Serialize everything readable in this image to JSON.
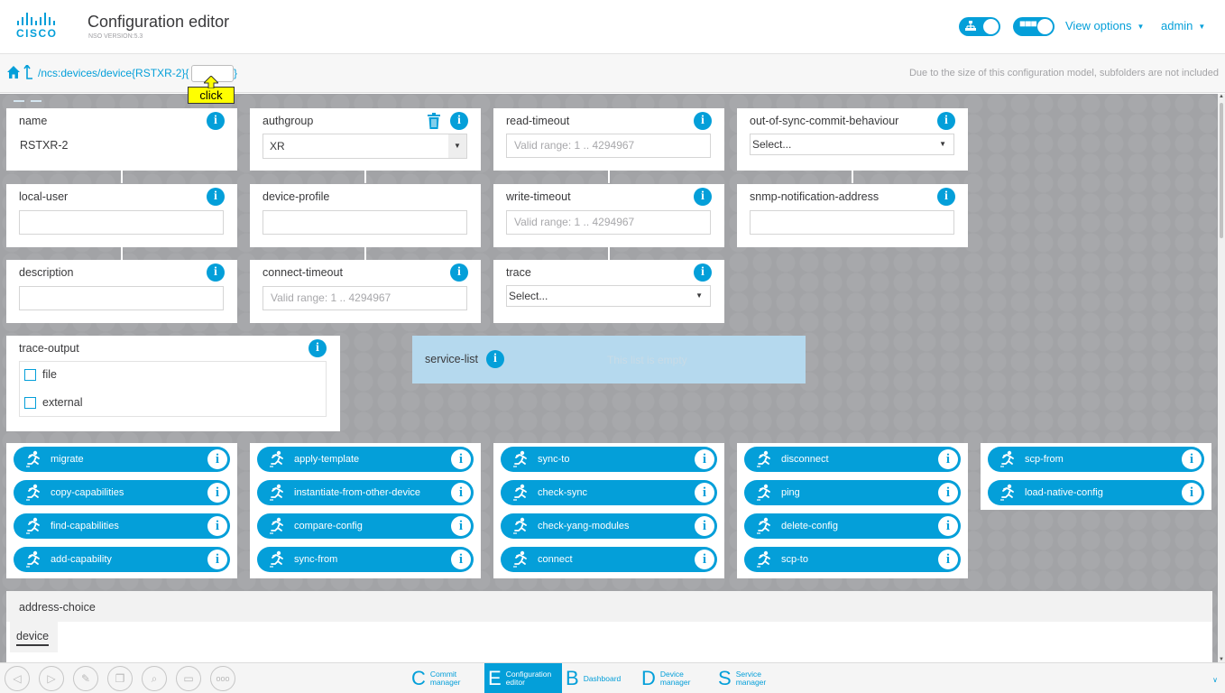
{
  "header": {
    "logo_text": "CISCO",
    "title": "Configuration editor",
    "version": "NSO VERSION:5.3",
    "view_options": "View options",
    "user": "admin"
  },
  "pathbar": {
    "path": "/ncs:devices/device{RSTXR-2}{",
    "path_close": "}",
    "input_value": "",
    "note": "Due to the size of this configuration model, subfolders are not included"
  },
  "tooltip": {
    "click": "click"
  },
  "fields": {
    "name": {
      "label": "name",
      "value": "RSTXR-2"
    },
    "authgroup": {
      "label": "authgroup",
      "value": "XR"
    },
    "read_timeout": {
      "label": "read-timeout",
      "placeholder": "Valid range: 1 .. 4294967"
    },
    "out_of_sync": {
      "label": "out-of-sync-commit-behaviour",
      "value": "Select..."
    },
    "local_user": {
      "label": "local-user",
      "value": ""
    },
    "device_profile": {
      "label": "device-profile",
      "value": ""
    },
    "write_timeout": {
      "label": "write-timeout",
      "placeholder": "Valid range: 1 .. 4294967"
    },
    "snmp": {
      "label": "snmp-notification-address",
      "value": ""
    },
    "description": {
      "label": "description",
      "value": ""
    },
    "connect_timeout": {
      "label": "connect-timeout",
      "placeholder": "Valid range: 1 .. 4294967"
    },
    "trace": {
      "label": "trace",
      "value": "Select..."
    },
    "trace_output": {
      "label": "trace-output",
      "options": [
        "file",
        "external"
      ]
    },
    "service_list": {
      "label": "service-list",
      "empty": "This list is empty"
    }
  },
  "actions": {
    "col1": [
      "migrate",
      "copy-capabilities",
      "find-capabilities",
      "add-capability"
    ],
    "col2": [
      "apply-template",
      "instantiate-from-other-device",
      "compare-config",
      "sync-from"
    ],
    "col3": [
      "sync-to",
      "check-sync",
      "check-yang-modules",
      "connect"
    ],
    "col4": [
      "disconnect",
      "ping",
      "delete-config",
      "scp-to"
    ],
    "col5": [
      "scp-from",
      "load-native-config"
    ]
  },
  "address_choice": {
    "label": "address-choice",
    "tab": "device"
  },
  "footer": {
    "tabs": [
      {
        "key": "C",
        "label1": "Commit",
        "label2": "manager"
      },
      {
        "key": "E",
        "label1": "Configuration",
        "label2": "editor"
      },
      {
        "key": "B",
        "label1": "Dashboard",
        "label2": ""
      },
      {
        "key": "D",
        "label1": "Device",
        "label2": "manager"
      },
      {
        "key": "S",
        "label1": "Service",
        "label2": "manager"
      }
    ],
    "icons": [
      "back-icon",
      "forward-icon",
      "edit-icon",
      "copy-icon",
      "search-icon",
      "keyboard-icon",
      "more-icon"
    ]
  },
  "colors": {
    "accent": "#049fd9",
    "background": "#a2a3a6",
    "tooltip": "#ffff00"
  }
}
